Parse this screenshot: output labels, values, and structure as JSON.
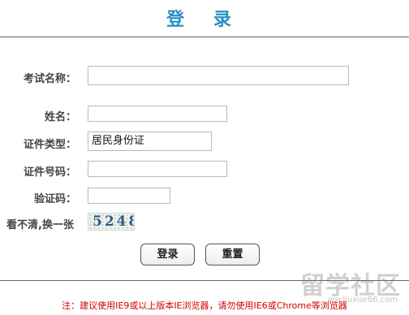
{
  "page": {
    "title": "登 录"
  },
  "form": {
    "exam_name": {
      "label": "考试名称：",
      "value": ""
    },
    "name": {
      "label": "姓名：",
      "value": ""
    },
    "id_type": {
      "label": "证件类型：",
      "value": "居民身份证"
    },
    "id_number": {
      "label": "证件号码：",
      "value": ""
    },
    "captcha": {
      "label": "验证码：",
      "value": ""
    },
    "refresh": {
      "label": "看不清,换一张",
      "code": "5248"
    }
  },
  "buttons": {
    "login": "登录",
    "reset": "重置"
  },
  "footer": {
    "note": "注：建议使用IE9或以上版本IE浏览器，请勿使用IE6或Chrome等浏览器"
  },
  "watermark": {
    "text": "留学社区",
    "url": "ww.liuxue86.com"
  }
}
